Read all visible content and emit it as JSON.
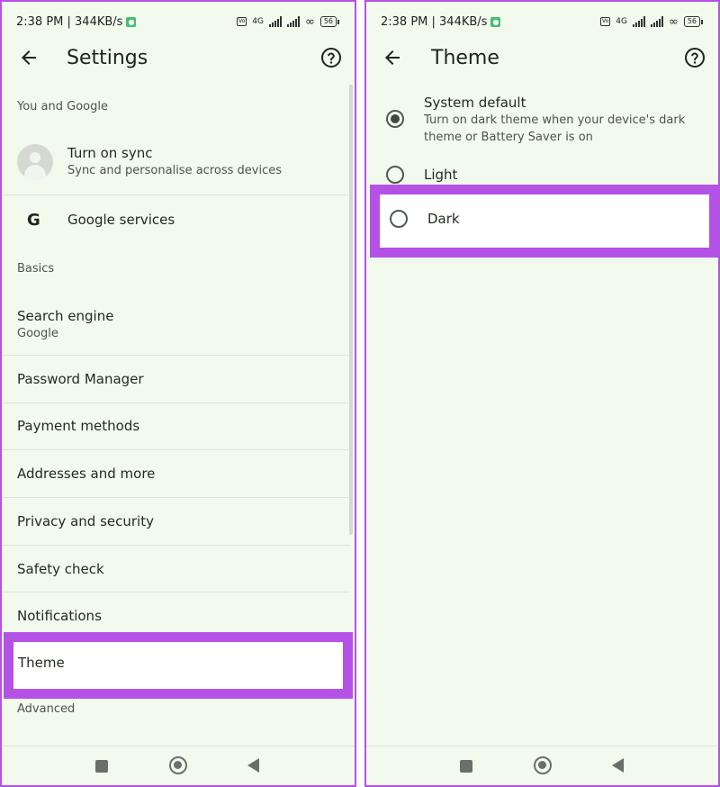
{
  "status_bar": {
    "time_speed": "2:38 PM | 344KB/s",
    "network": "4G",
    "battery": "56"
  },
  "left_screen": {
    "title": "Settings",
    "sections": {
      "you_and_google": "You and Google",
      "basics": "Basics",
      "advanced": "Advanced"
    },
    "sync": {
      "title": "Turn on sync",
      "subtitle": "Sync and personalise across devices"
    },
    "google_services": {
      "icon": "G",
      "title": "Google services"
    },
    "search_engine": {
      "title": "Search engine",
      "value": "Google"
    },
    "items": {
      "password_manager": "Password Manager",
      "payment_methods": "Payment methods",
      "addresses": "Addresses and more",
      "privacy": "Privacy and security",
      "safety_check": "Safety check",
      "notifications": "Notifications",
      "theme": "Theme"
    }
  },
  "right_screen": {
    "title": "Theme",
    "options": [
      {
        "label": "System default",
        "description": "Turn on dark theme when your device's dark theme or Battery Saver is on",
        "selected": true
      },
      {
        "label": "Light",
        "selected": false
      },
      {
        "label": "Dark",
        "selected": false
      }
    ]
  },
  "colors": {
    "highlight": "#b552e6",
    "background": "#f1faec"
  }
}
